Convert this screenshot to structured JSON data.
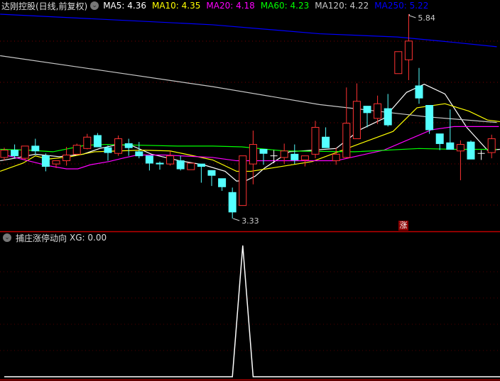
{
  "header": {
    "title": "达刚控股(日线,前复权)",
    "ma_labels": [
      {
        "text": "MA5: 4.36",
        "color": "#ffffff"
      },
      {
        "text": "MA10: 4.35",
        "color": "#ffff00"
      },
      {
        "text": "MA20: 4.18",
        "color": "#ff00ff"
      },
      {
        "text": "MA60: 4.23",
        "color": "#00ff00"
      },
      {
        "text": "MA120: 4.22",
        "color": "#c8c8c8"
      },
      {
        "text": "MA250: 5.22",
        "color": "#0000ff"
      }
    ]
  },
  "indicator": {
    "name": "捕庄涨停动向",
    "value_label": "XG: 0.00"
  },
  "signal_badge": "涨",
  "colors": {
    "up": "#ff3232",
    "down": "#54ffff",
    "doji": "#ffffff",
    "grid": "#7a0000",
    "divider": "#c00000"
  },
  "chart_data": {
    "type": "candlestick",
    "price_range": [
      3.33,
      5.84
    ],
    "annotations": [
      {
        "index": 39,
        "field": "high",
        "text": "5.84"
      },
      {
        "index": 22,
        "field": "low",
        "text": "3.33"
      }
    ],
    "candles": [
      [
        4.08,
        4.2,
        4.04,
        4.17
      ],
      [
        4.17,
        4.24,
        4.07,
        4.1
      ],
      [
        4.07,
        4.22,
        4.05,
        4.22
      ],
      [
        4.22,
        4.31,
        4.11,
        4.16
      ],
      [
        4.1,
        4.13,
        3.91,
        3.97
      ],
      [
        4.0,
        4.04,
        3.95,
        4.04
      ],
      [
        4.04,
        4.21,
        3.98,
        4.11
      ],
      [
        4.12,
        4.25,
        4.11,
        4.23
      ],
      [
        4.19,
        4.37,
        4.18,
        4.33
      ],
      [
        4.35,
        4.38,
        4.21,
        4.21
      ],
      [
        4.2,
        4.23,
        4.04,
        4.14
      ],
      [
        4.13,
        4.35,
        4.1,
        4.31
      ],
      [
        4.25,
        4.31,
        4.1,
        4.2
      ],
      [
        4.15,
        4.27,
        4.07,
        4.1
      ],
      [
        4.1,
        4.1,
        3.92,
        4.01
      ],
      [
        4.01,
        4.03,
        3.93,
        4.0
      ],
      [
        4.0,
        4.16,
        3.98,
        4.1
      ],
      [
        4.04,
        4.1,
        3.92,
        3.94
      ],
      [
        3.93,
        4.01,
        3.93,
        4.01
      ],
      [
        4.0,
        4.0,
        3.77,
        3.97
      ],
      [
        3.92,
        3.92,
        3.73,
        3.86
      ],
      [
        3.82,
        3.82,
        3.67,
        3.72
      ],
      [
        3.65,
        3.71,
        3.33,
        3.41
      ],
      [
        3.49,
        4.1,
        3.49,
        4.1
      ],
      [
        4.0,
        4.41,
        3.75,
        4.24
      ],
      [
        4.18,
        4.18,
        3.99,
        4.13
      ],
      [
        4.1,
        4.17,
        4.01,
        4.1
      ],
      [
        4.08,
        4.25,
        4.0,
        4.16
      ],
      [
        4.12,
        4.24,
        4.0,
        4.05
      ],
      [
        4.05,
        4.1,
        3.97,
        4.1
      ],
      [
        4.12,
        4.53,
        4.07,
        4.45
      ],
      [
        4.33,
        4.45,
        4.2,
        4.2
      ],
      [
        4.04,
        4.2,
        3.99,
        4.12
      ],
      [
        4.08,
        4.94,
        4.07,
        4.5
      ],
      [
        4.31,
        4.99,
        4.31,
        4.77
      ],
      [
        4.71,
        4.71,
        4.45,
        4.63
      ],
      [
        4.56,
        4.84,
        4.49,
        4.74
      ],
      [
        4.68,
        4.86,
        4.46,
        4.48
      ],
      [
        5.11,
        5.38,
        5.11,
        5.38
      ],
      [
        5.28,
        5.84,
        5.03,
        5.51
      ],
      [
        4.96,
        5.18,
        4.74,
        4.81
      ],
      [
        4.72,
        4.72,
        4.37,
        4.42
      ],
      [
        4.37,
        4.37,
        4.17,
        4.25
      ],
      [
        4.26,
        4.67,
        4.18,
        4.18
      ],
      [
        4.16,
        4.29,
        3.8,
        4.24
      ],
      [
        4.27,
        4.29,
        4.06,
        4.06
      ],
      [
        4.13,
        4.17,
        4.05,
        4.13
      ],
      [
        4.14,
        4.36,
        4.07,
        4.31
      ]
    ],
    "candle_fields": [
      "open",
      "high",
      "low",
      "close"
    ],
    "ma_series": [
      {
        "name": "MA5",
        "color": "#ffffff",
        "points": [
          [
            -0.4,
            4.04
          ],
          [
            1.0,
            4.07
          ],
          [
            3.0,
            4.12
          ],
          [
            5.3,
            4.09
          ],
          [
            7.6,
            4.12
          ],
          [
            9.2,
            4.19
          ],
          [
            11.0,
            4.24
          ],
          [
            12.4,
            4.22
          ],
          [
            14.2,
            4.12
          ],
          [
            16.9,
            4.04
          ],
          [
            19.2,
            3.99
          ],
          [
            21.3,
            3.91
          ],
          [
            22.4,
            3.79
          ],
          [
            23.4,
            3.8
          ],
          [
            24.2,
            3.85
          ],
          [
            25.1,
            3.95
          ],
          [
            27.5,
            4.15
          ],
          [
            32.0,
            4.19
          ],
          [
            34.3,
            4.42
          ],
          [
            36.6,
            4.56
          ],
          [
            38.8,
            4.88
          ],
          [
            40.5,
            4.98
          ],
          [
            42.5,
            4.86
          ],
          [
            44.6,
            4.45
          ],
          [
            46.6,
            4.17
          ],
          [
            47.8,
            4.18
          ]
        ]
      },
      {
        "name": "MA10",
        "color": "#ffff00",
        "points": [
          [
            -0.4,
            3.91
          ],
          [
            1.8,
            4.01
          ],
          [
            3.0,
            4.1
          ],
          [
            4.2,
            4.06
          ],
          [
            6.4,
            4.09
          ],
          [
            8.7,
            4.15
          ],
          [
            11.0,
            4.16
          ],
          [
            13.3,
            4.17
          ],
          [
            16.0,
            4.16
          ],
          [
            17.9,
            4.11
          ],
          [
            20.1,
            4.05
          ],
          [
            22.4,
            3.91
          ],
          [
            23.8,
            3.91
          ],
          [
            29.7,
            4.03
          ],
          [
            34.3,
            4.25
          ],
          [
            37.5,
            4.4
          ],
          [
            39.8,
            4.69
          ],
          [
            42.5,
            4.74
          ],
          [
            44.8,
            4.65
          ],
          [
            46.6,
            4.54
          ],
          [
            47.8,
            4.52
          ]
        ]
      },
      {
        "name": "MA20",
        "color": "#ff00ff",
        "points": [
          [
            0.1,
            4.11
          ],
          [
            2.3,
            4.04
          ],
          [
            4.2,
            3.98
          ],
          [
            6.0,
            3.94
          ],
          [
            7.1,
            3.94
          ],
          [
            8.3,
            3.99
          ],
          [
            10.1,
            4.03
          ],
          [
            11.4,
            4.07
          ],
          [
            12.8,
            4.11
          ],
          [
            15.5,
            4.11
          ],
          [
            20.1,
            4.08
          ],
          [
            22.4,
            4.04
          ],
          [
            24.2,
            4.04
          ],
          [
            32.0,
            4.04
          ],
          [
            36.6,
            4.17
          ],
          [
            41.2,
            4.42
          ],
          [
            43.4,
            4.46
          ],
          [
            47.7,
            4.46
          ]
        ]
      },
      {
        "name": "MA60",
        "color": "#00ff00",
        "points": [
          [
            -0.4,
            4.18
          ],
          [
            2.3,
            4.17
          ],
          [
            4.7,
            4.15
          ],
          [
            7.8,
            4.23
          ],
          [
            9.9,
            4.24
          ],
          [
            16.7,
            4.22
          ],
          [
            20.1,
            4.22
          ],
          [
            22.9,
            4.21
          ],
          [
            27.0,
            4.16
          ],
          [
            33.8,
            4.15
          ],
          [
            40.0,
            4.19
          ],
          [
            43.4,
            4.18
          ],
          [
            47.5,
            4.18
          ]
        ]
      },
      {
        "name": "MA120",
        "color": "#c8c8c8",
        "points": [
          [
            -0.4,
            5.33
          ],
          [
            9.9,
            5.14
          ],
          [
            20.1,
            4.95
          ],
          [
            30.4,
            4.73
          ],
          [
            35.9,
            4.65
          ],
          [
            40.7,
            4.58
          ],
          [
            47.5,
            4.51
          ]
        ]
      },
      {
        "name": "MA250",
        "color": "#0000ff",
        "points": [
          [
            -0.4,
            5.84
          ],
          [
            20.1,
            5.71
          ],
          [
            30.4,
            5.6
          ],
          [
            37.9,
            5.56
          ],
          [
            42.1,
            5.51
          ],
          [
            47.5,
            5.44
          ]
        ]
      }
    ],
    "indicator_series": {
      "name": "XG",
      "range": [
        0,
        1
      ],
      "values": [
        0,
        0,
        0,
        0,
        0,
        0,
        0,
        0,
        0,
        0,
        0,
        0,
        0,
        0,
        0,
        0,
        0,
        0,
        0,
        0,
        0,
        0,
        0,
        1,
        0,
        0,
        0,
        0,
        0,
        0,
        0,
        0,
        0,
        0,
        0,
        0,
        0,
        0,
        0,
        0,
        0,
        0,
        0,
        0,
        0,
        0,
        0,
        0
      ]
    }
  }
}
